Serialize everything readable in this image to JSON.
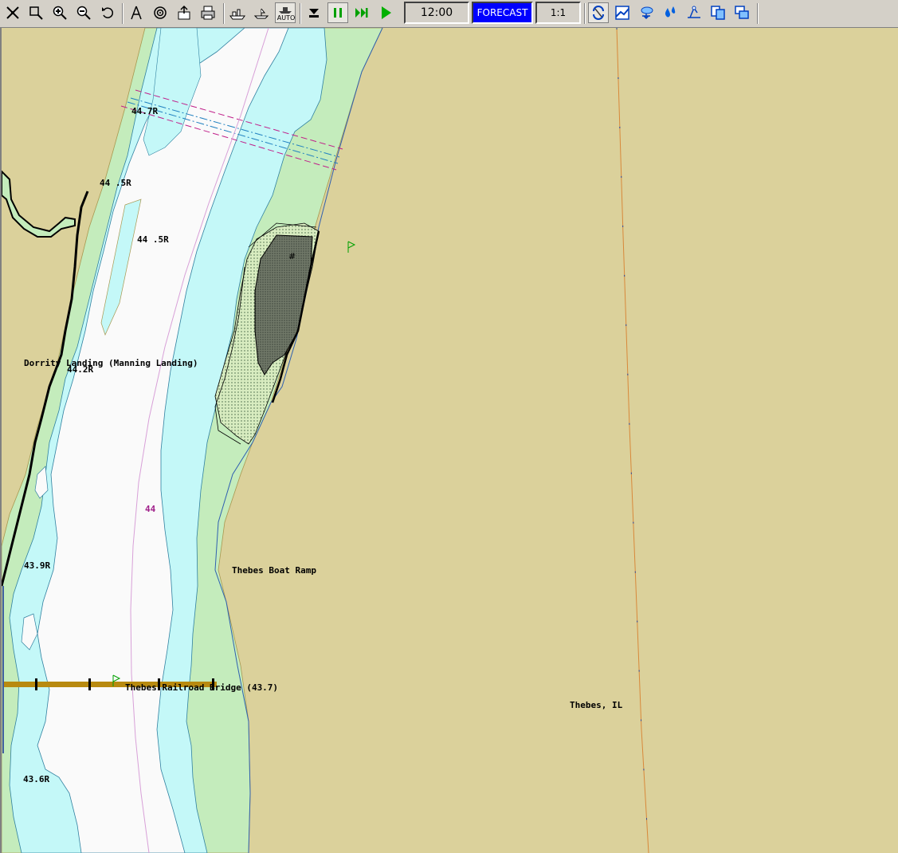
{
  "toolbar": {
    "buttons": [
      {
        "icon": "full-extent-icon"
      },
      {
        "icon": "zoom-box-icon"
      },
      {
        "icon": "zoom-in-icon"
      },
      {
        "icon": "zoom-out-icon"
      },
      {
        "icon": "undo-view-icon"
      },
      {
        "icon": "measure-icon"
      },
      {
        "icon": "target-icon"
      },
      {
        "icon": "export-icon"
      },
      {
        "icon": "print-icon"
      },
      {
        "icon": "vessel-icon"
      },
      {
        "icon": "boat-icon"
      },
      {
        "icon": "auto-track-icon",
        "label": "AUTO"
      },
      {
        "icon": "stop-icon"
      },
      {
        "icon": "pause-icon"
      },
      {
        "icon": "fast-forward-icon"
      },
      {
        "icon": "play-icon"
      },
      {
        "icon": "rotate-chart-icon"
      },
      {
        "icon": "chart-overlay-icon"
      },
      {
        "icon": "weather-icon"
      },
      {
        "icon": "water-level-icon"
      },
      {
        "icon": "route-icon"
      },
      {
        "icon": "copy-icon"
      },
      {
        "icon": "windows-icon"
      }
    ],
    "time": "12:00",
    "forecast_label": "FORECAST",
    "scale": "1:1"
  },
  "chart": {
    "colors": {
      "land": "#dbd19b",
      "shallow_water": "#c4f8f8",
      "deep_water": "#fafafa",
      "shore": "#c4ecbc",
      "bridge": "#b88a10",
      "sailing_line": "#d8a0d8",
      "boundary": "#d8883a"
    },
    "labels": {
      "mile_447": "44.7R",
      "mile_445a": "44 .5R",
      "mile_445b": "44 .5R",
      "dorrity": "Dorrity Landing (Manning Landing)",
      "mile_442": "44.2R",
      "mile_44": "44",
      "mile_439": "43.9R",
      "boat_ramp": "Thebes Boat Ramp",
      "bridge": "Thebes Railroad Bridge (43.7)",
      "town": "Thebes, IL",
      "mile_436": "43.6R"
    }
  }
}
